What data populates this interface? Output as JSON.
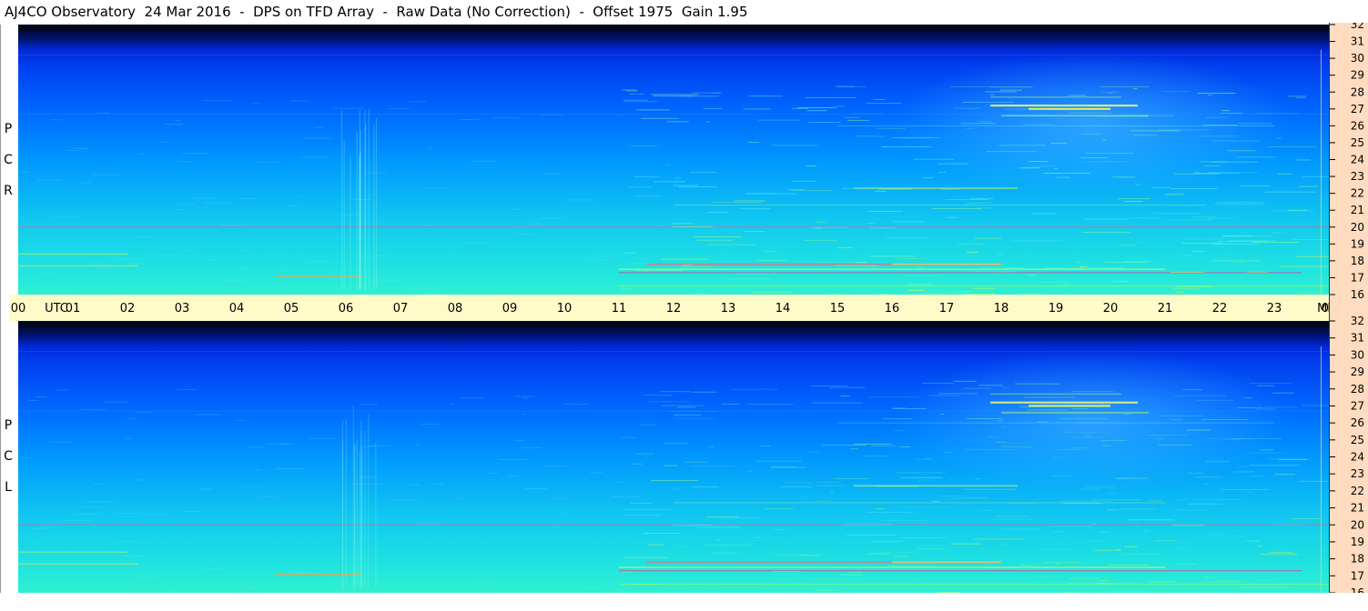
{
  "header": {
    "title": "AJ4CO Observatory  24 Mar 2016  -  DPS on TFD Array  -  Raw Data (No Correction)  -  Offset 1975  Gain 1.95"
  },
  "panels": {
    "top_label": [
      "R",
      "C",
      "P"
    ],
    "bottom_label": [
      "L",
      "C",
      "P"
    ]
  },
  "chart_data": {
    "type": "heatmap",
    "title": "AJ4CO Observatory  24 Mar 2016  -  DPS on TFD Array  -  Raw Data (No Correction)  -  Offset 1975  Gain 1.95",
    "x_label_left": "UTC",
    "x_label_right": "MHz",
    "x_ticks": [
      "00",
      "01",
      "02",
      "03",
      "04",
      "05",
      "06",
      "07",
      "08",
      "09",
      "10",
      "11",
      "12",
      "13",
      "14",
      "15",
      "16",
      "17",
      "18",
      "19",
      "20",
      "21",
      "22",
      "23",
      "00"
    ],
    "x_range_hours": [
      0,
      24
    ],
    "y_ticks": [
      "16",
      "17",
      "18",
      "19",
      "20",
      "21",
      "22",
      "23",
      "24",
      "25",
      "26",
      "27",
      "28",
      "29",
      "30",
      "31",
      "32"
    ],
    "y_range_mhz": [
      16,
      32
    ],
    "panels": [
      "RCP",
      "LCP"
    ],
    "colormap": [
      "#000018",
      "#0010c0",
      "#0060ff",
      "#00b0ff",
      "#10e0e0",
      "#a0ff60",
      "#ffff00",
      "#ff4080"
    ],
    "grid": false
  }
}
